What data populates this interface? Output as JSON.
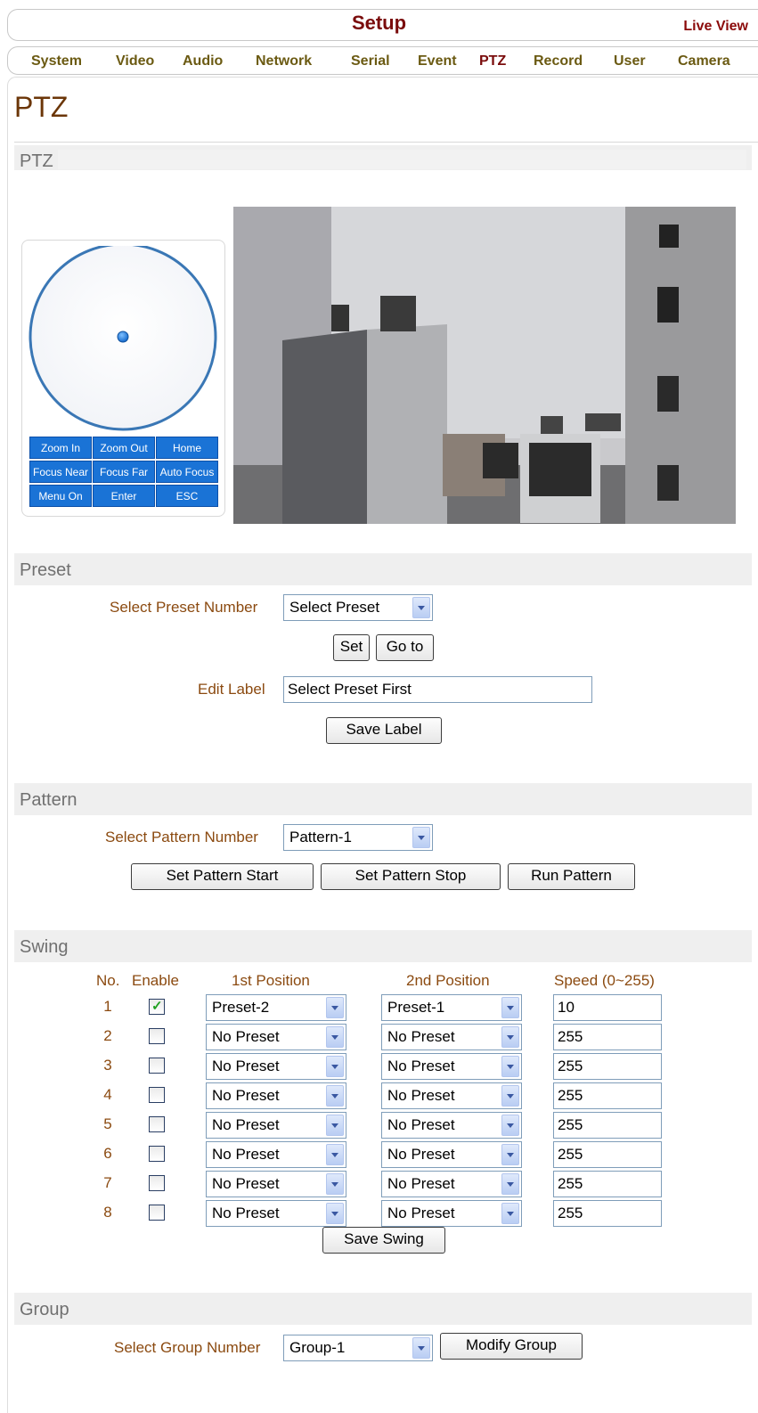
{
  "header": {
    "title": "Setup",
    "live_view": "Live View"
  },
  "nav": [
    "System",
    "Video",
    "Audio",
    "Network",
    "Serial",
    "Event",
    "PTZ",
    "Record",
    "User",
    "Camera"
  ],
  "page_title": "PTZ",
  "ptz_section": {
    "title": "PTZ",
    "buttons": [
      "Zoom In",
      "Zoom Out",
      "Home",
      "Focus Near",
      "Focus Far",
      "Auto Focus",
      "Menu On",
      "Enter",
      "ESC"
    ]
  },
  "preset": {
    "title": "Preset",
    "select_label": "Select Preset Number",
    "select_value": "Select Preset",
    "set_label": "Set",
    "goto_label": "Go to",
    "edit_label": "Edit Label",
    "edit_value": "Select Preset First",
    "save_label": "Save Label"
  },
  "pattern": {
    "title": "Pattern",
    "select_label": "Select Pattern Number",
    "select_value": "Pattern-1",
    "start": "Set Pattern Start",
    "stop": "Set Pattern Stop",
    "run": "Run Pattern"
  },
  "swing": {
    "title": "Swing",
    "headers": {
      "no": "No.",
      "enable": "Enable",
      "first": "1st Position",
      "second": "2nd Position",
      "speed": "Speed (0~255)"
    },
    "rows": [
      {
        "no": "1",
        "enabled": true,
        "first": "Preset-2",
        "second": "Preset-1",
        "speed": "10"
      },
      {
        "no": "2",
        "enabled": false,
        "first": "No Preset",
        "second": "No Preset",
        "speed": "255"
      },
      {
        "no": "3",
        "enabled": false,
        "first": "No Preset",
        "second": "No Preset",
        "speed": "255"
      },
      {
        "no": "4",
        "enabled": false,
        "first": "No Preset",
        "second": "No Preset",
        "speed": "255"
      },
      {
        "no": "5",
        "enabled": false,
        "first": "No Preset",
        "second": "No Preset",
        "speed": "255"
      },
      {
        "no": "6",
        "enabled": false,
        "first": "No Preset",
        "second": "No Preset",
        "speed": "255"
      },
      {
        "no": "7",
        "enabled": false,
        "first": "No Preset",
        "second": "No Preset",
        "speed": "255"
      },
      {
        "no": "8",
        "enabled": false,
        "first": "No Preset",
        "second": "No Preset",
        "speed": "255"
      }
    ],
    "save": "Save Swing"
  },
  "group": {
    "title": "Group",
    "select_label": "Select Group Number",
    "select_value": "Group-1",
    "modify": "Modify Group"
  },
  "colors": {
    "brand_dark_red": "#7a0c0c",
    "label_brown": "#8b4a10",
    "ptz_button_blue": "#1a73d6"
  },
  "icons": {
    "dropdown": "chevron-down-icon",
    "checkbox_checked": "check-icon"
  }
}
